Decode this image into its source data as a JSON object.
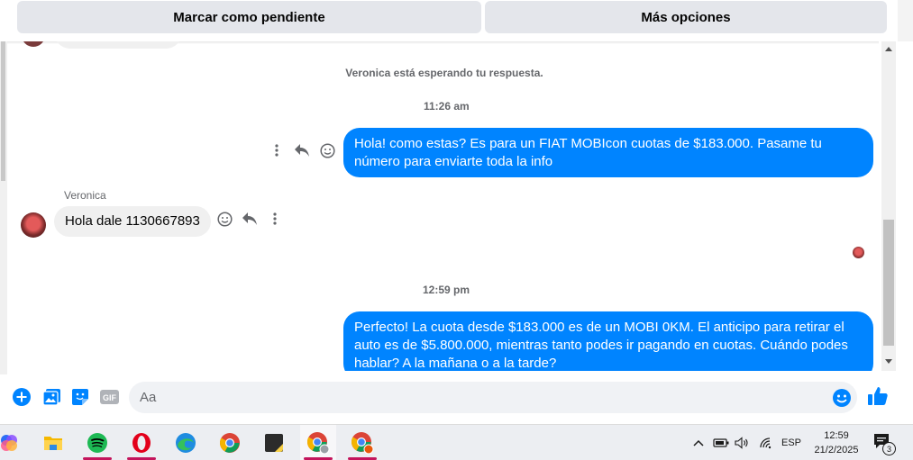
{
  "header": {
    "mark_pending_label": "Marcar como pendiente",
    "more_options_label": "Más opciones"
  },
  "conversation": {
    "waiting_note": "Veronica está esperando tu respuesta.",
    "messages": [
      {
        "type": "timestamp",
        "text": "11:26 am"
      },
      {
        "type": "outgoing",
        "text": "Hola! como estas? Es para un FIAT MOBIcon cuotas de $183.000. Pasame tu número para enviarte toda la info"
      },
      {
        "type": "incoming",
        "sender": "Veronica",
        "text": "Hola dale 1130667893"
      },
      {
        "type": "timestamp",
        "text": "12:59 pm"
      },
      {
        "type": "outgoing",
        "text": "Perfecto! La cuota desde $183.000 es de un MOBI 0KM. El anticipo para retirar el auto es de $5.800.000, mientras tanto podes ir pagando en cuotas. Cuándo podes hablar? A la mañana o a la tarde?"
      }
    ]
  },
  "composer": {
    "placeholder": "Aa",
    "value": ""
  },
  "taskbar": {
    "apps": [
      "copilot-icon",
      "file-explorer-icon",
      "spotify-icon",
      "opera-icon",
      "edge-icon",
      "chrome-icon",
      "sticky-notes-icon",
      "chrome-profile-icon",
      "chrome-profile-2-icon"
    ],
    "language": "ESP",
    "time": "12:59",
    "date": "21/2/2025",
    "notification_count": "3"
  },
  "colors": {
    "outgoing_bubble": "#0084ff",
    "incoming_bubble": "#f0f0f0",
    "accent": "#0084ff"
  }
}
